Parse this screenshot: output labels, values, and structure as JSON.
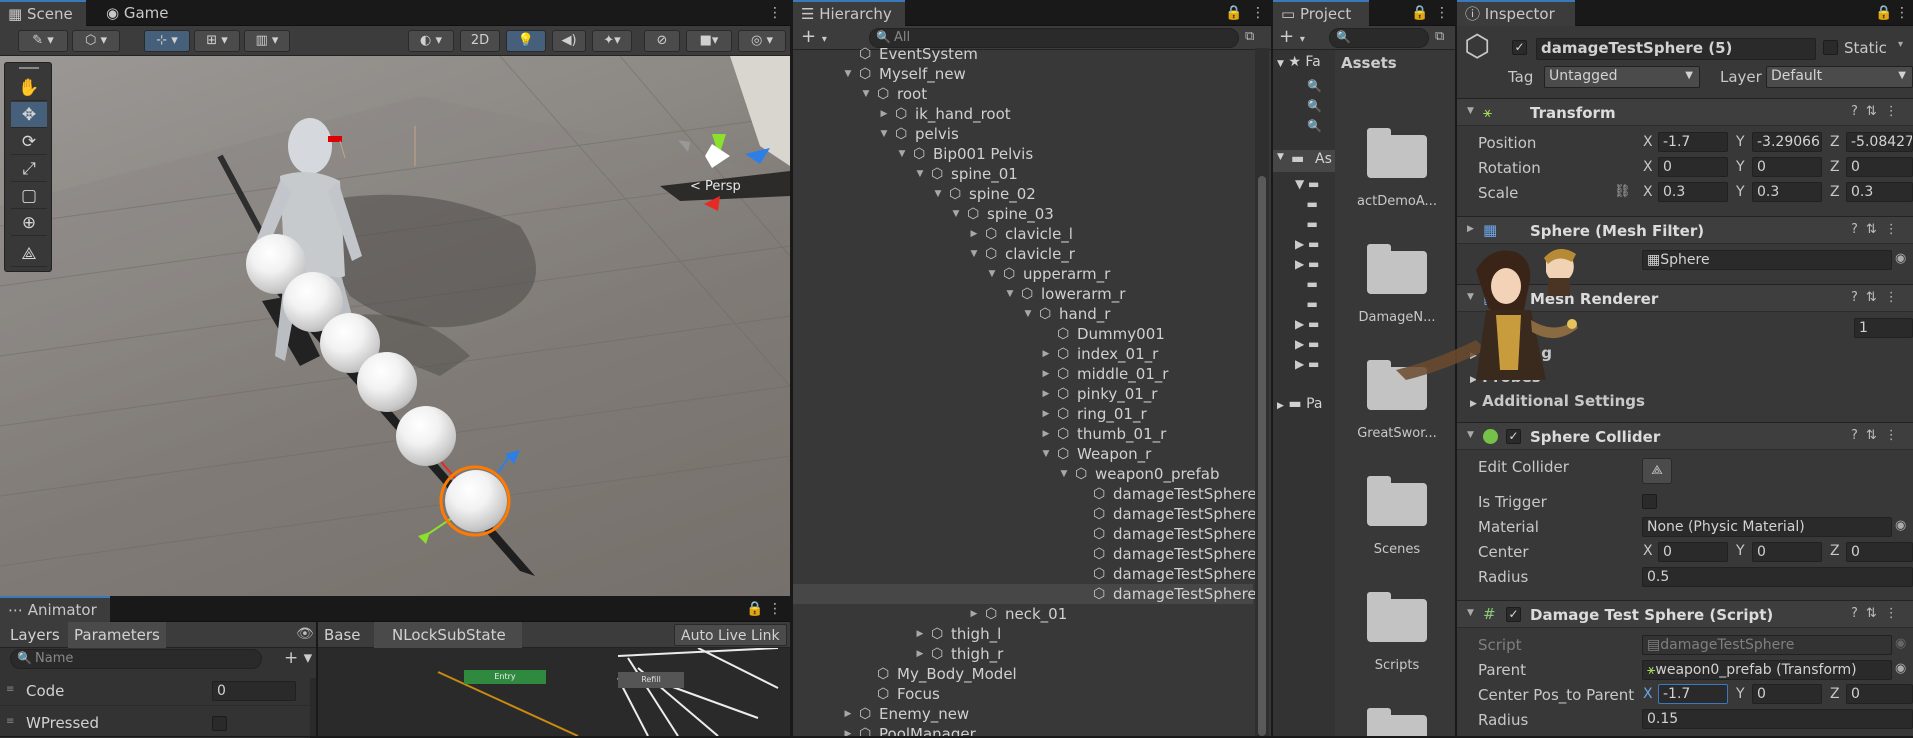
{
  "colors": {
    "accent": "#3a79bb",
    "selection": "#474747",
    "panel": "#383838",
    "orange": "#ff7a00"
  },
  "scene": {
    "tabs": [
      "Scene",
      "Game"
    ],
    "toolbar": {
      "mode_2d": "2D"
    },
    "persp_label": "< Persp",
    "tools": [
      "hand-icon",
      "move-icon",
      "rotate-icon",
      "scale-icon",
      "rect-icon",
      "transform-icon",
      "custom-tool-icon"
    ]
  },
  "animator": {
    "tab": "Animator",
    "tabs": [
      "Layers",
      "Parameters"
    ],
    "search_placeholder": "Name",
    "breadcrumb": [
      "Base",
      "NLockSubState"
    ],
    "auto_live_link": "Auto Live Link",
    "params": [
      {
        "name": "Code",
        "value": "0",
        "type": "int"
      },
      {
        "name": "WPressed",
        "value": "",
        "type": "bool"
      }
    ],
    "nodes": {
      "entry": "Entry",
      "other": "Refill"
    }
  },
  "hierarchy": {
    "tab": "Hierarchy",
    "search_placeholder": "All",
    "rows": [
      {
        "name": "EventSystem",
        "depth": 0,
        "arrow": "",
        "selected": false
      },
      {
        "name": "Myself_new",
        "depth": 0,
        "arrow": "open",
        "selected": false
      },
      {
        "name": "root",
        "depth": 1,
        "arrow": "open",
        "selected": false
      },
      {
        "name": "ik_hand_root",
        "depth": 2,
        "arrow": "closed",
        "selected": false
      },
      {
        "name": "pelvis",
        "depth": 2,
        "arrow": "open",
        "selected": false
      },
      {
        "name": "Bip001 Pelvis",
        "depth": 3,
        "arrow": "open",
        "selected": false
      },
      {
        "name": "spine_01",
        "depth": 4,
        "arrow": "open",
        "selected": false
      },
      {
        "name": "spine_02",
        "depth": 5,
        "arrow": "open",
        "selected": false
      },
      {
        "name": "spine_03",
        "depth": 6,
        "arrow": "open",
        "selected": false
      },
      {
        "name": "clavicle_l",
        "depth": 7,
        "arrow": "closed",
        "selected": false
      },
      {
        "name": "clavicle_r",
        "depth": 7,
        "arrow": "open",
        "selected": false
      },
      {
        "name": "upperarm_r",
        "depth": 8,
        "arrow": "open",
        "selected": false
      },
      {
        "name": "lowerarm_r",
        "depth": 9,
        "arrow": "open",
        "selected": false
      },
      {
        "name": "hand_r",
        "depth": 10,
        "arrow": "open",
        "selected": false
      },
      {
        "name": "Dummy001",
        "depth": 11,
        "arrow": "",
        "selected": false
      },
      {
        "name": "index_01_r",
        "depth": 11,
        "arrow": "closed",
        "selected": false
      },
      {
        "name": "middle_01_r",
        "depth": 11,
        "arrow": "closed",
        "selected": false
      },
      {
        "name": "pinky_01_r",
        "depth": 11,
        "arrow": "closed",
        "selected": false
      },
      {
        "name": "ring_01_r",
        "depth": 11,
        "arrow": "closed",
        "selected": false
      },
      {
        "name": "thumb_01_r",
        "depth": 11,
        "arrow": "closed",
        "selected": false
      },
      {
        "name": "Weapon_r",
        "depth": 11,
        "arrow": "open",
        "selected": false
      },
      {
        "name": "weapon0_prefab",
        "depth": 12,
        "arrow": "open",
        "selected": false
      },
      {
        "name": "damageTestSphere",
        "depth": 13,
        "arrow": "",
        "selected": false
      },
      {
        "name": "damageTestSphere",
        "depth": 13,
        "arrow": "",
        "selected": false
      },
      {
        "name": "damageTestSphere",
        "depth": 13,
        "arrow": "",
        "selected": false
      },
      {
        "name": "damageTestSphere",
        "depth": 13,
        "arrow": "",
        "selected": false
      },
      {
        "name": "damageTestSphere",
        "depth": 13,
        "arrow": "",
        "selected": false
      },
      {
        "name": "damageTestSphere",
        "depth": 13,
        "arrow": "",
        "selected": true
      },
      {
        "name": "neck_01",
        "depth": 7,
        "arrow": "closed",
        "selected": false
      },
      {
        "name": "thigh_l",
        "depth": 4,
        "arrow": "closed",
        "selected": false
      },
      {
        "name": "thigh_r",
        "depth": 4,
        "arrow": "closed",
        "selected": false
      },
      {
        "name": "My_Body_Model",
        "depth": 1,
        "arrow": "",
        "selected": false
      },
      {
        "name": "Focus",
        "depth": 1,
        "arrow": "",
        "selected": false
      },
      {
        "name": "Enemy_new",
        "depth": 0,
        "arrow": "closed",
        "selected": false
      },
      {
        "name": "PoolManager",
        "depth": 0,
        "arrow": "closed",
        "selected": false
      }
    ]
  },
  "project": {
    "tab": "Project",
    "assets_header": "Assets",
    "tree_fav": "Fa",
    "tree_assets": "As",
    "tree_packages": "Pa",
    "folders": [
      "actDemoA...",
      "DamageN...",
      "GreatSwor...",
      "Scenes",
      "Scripts",
      ""
    ]
  },
  "inspector": {
    "tab": "Inspector",
    "object_name": "damageTestSphere (5)",
    "static_label": "Static",
    "tag_label": "Tag",
    "tag_value": "Untagged",
    "layer_label": "Layer",
    "layer_value": "Default",
    "transform": {
      "title": "Transform",
      "position": {
        "label": "Position",
        "x": "-1.7",
        "y": "-3.29066",
        "z": "-5.08427"
      },
      "rotation": {
        "label": "Rotation",
        "x": "0",
        "y": "0",
        "z": "0"
      },
      "scale": {
        "label": "Scale",
        "x": "0.3",
        "y": "0.3",
        "z": "0.3"
      }
    },
    "mesh_filter": {
      "title": "Sphere (Mesh Filter)",
      "mesh": "Sphere"
    },
    "mesh_renderer": {
      "title": "Mesh Renderer",
      "value": "1",
      "lighting": "Lighting",
      "probes": "Probes",
      "additional": "Additional Settings"
    },
    "sphere_collider": {
      "title": "Sphere Collider",
      "edit_collider": "Edit Collider",
      "is_trigger": "Is Trigger",
      "material_label": "Material",
      "material_value": "None (Physic Material)",
      "center_label": "Center",
      "center": {
        "x": "0",
        "y": "0",
        "z": "0"
      },
      "radius_label": "Radius",
      "radius": "0.5"
    },
    "script": {
      "title": "Damage Test Sphere (Script)",
      "script_label": "Script",
      "script_value": "damageTestSphere",
      "parent_label": "Parent",
      "parent_value": "weapon0_prefab (Transform)",
      "center_label": "Center Pos_to Parent",
      "center": {
        "x": "-1.7",
        "y": "0",
        "z": "0"
      },
      "radius_label": "Radius",
      "radius": "0.15"
    }
  }
}
